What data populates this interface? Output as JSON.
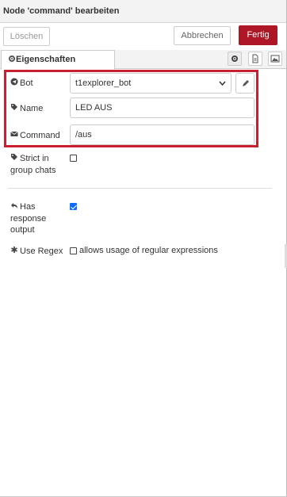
{
  "header": {
    "title": "Node 'command' bearbeiten"
  },
  "toolbar": {
    "delete_label": "Löschen",
    "cancel_label": "Abbrechen",
    "done_label": "Fertig"
  },
  "tabs": {
    "properties_label": "Eigenschaften"
  },
  "form": {
    "bot": {
      "label": "Bot",
      "value": "t1explorer_bot"
    },
    "name": {
      "label": "Name",
      "value": "LED AUS"
    },
    "command": {
      "label": "Command",
      "value": "/aus"
    },
    "strict": {
      "label_line1": "Strict in",
      "label_line2": "group chats",
      "checked": false
    },
    "response": {
      "label_line1": "Has",
      "label_line2": "response",
      "label_line3": "output",
      "checked": true
    },
    "regex": {
      "label": "Use Regex",
      "checked": false,
      "description": "allows usage of regular expressions"
    }
  },
  "colors": {
    "accent": "#ad1625",
    "highlight": "#c8202f",
    "checkbox": "#0d6efd"
  },
  "icons": [
    "gear-icon",
    "document-icon",
    "appearance-icon",
    "telegram-icon",
    "tag-icon",
    "envelope-icon",
    "reply-icon",
    "asterisk-icon",
    "pencil-icon",
    "chevron-down-icon"
  ]
}
